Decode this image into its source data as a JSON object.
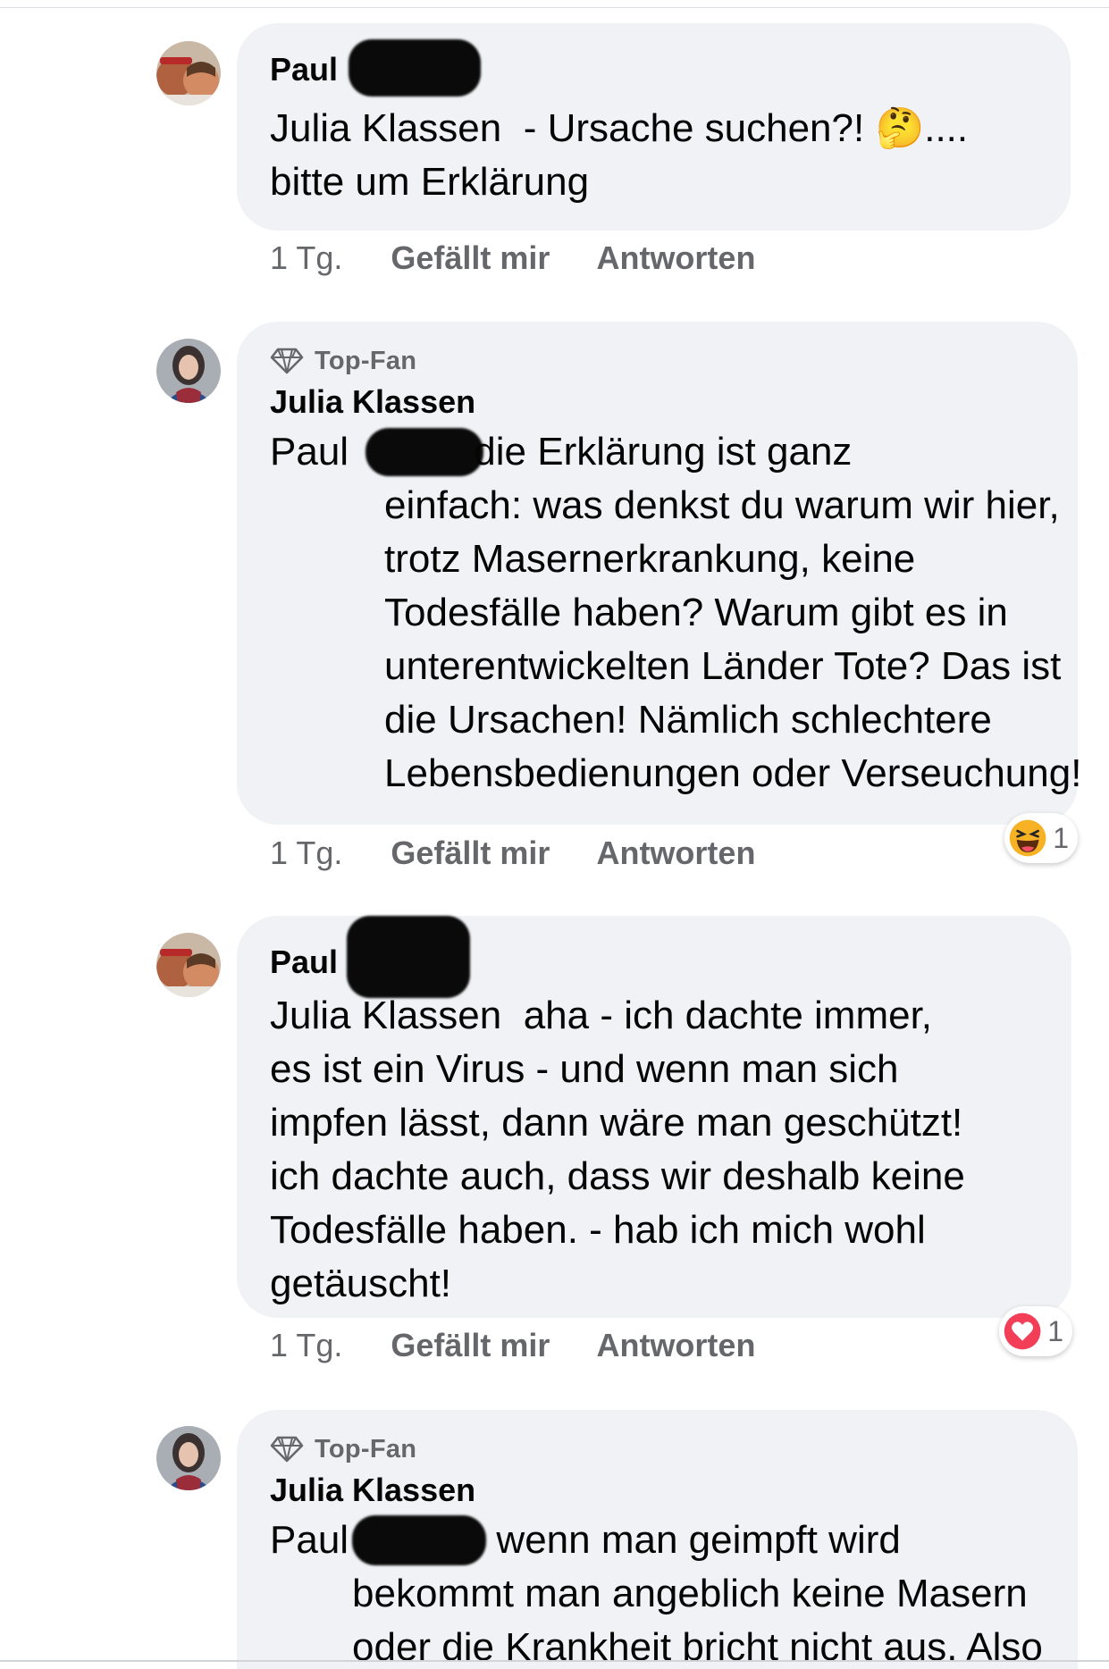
{
  "comments": [
    {
      "author": "Paul",
      "top_fan": false,
      "text": "Julia Klassen  - Ursache suchen?! 🤔....\nbitte um Erklärung",
      "time": "1 Tg.",
      "like_label": "Gefällt mir",
      "reply_label": "Antworten"
    },
    {
      "author": "Julia Klassen",
      "top_fan": true,
      "badge": "Top-Fan",
      "mention": "Paul",
      "text": " die Erklärung ist ganz\neinfach: was denkst du warum wir hier,\ntrotz Masernerkrankung, keine\nTodesfälle haben? Warum gibt es in\nunterentwickelten Länder Tote? Das ist\ndie Ursachen! Nämlich schlechtere\nLebensbedienungen oder Verseuchung!",
      "time": "1 Tg.",
      "like_label": "Gefällt mir",
      "reply_label": "Antworten",
      "reaction": {
        "icon": "haha-reaction-icon",
        "count": "1"
      }
    },
    {
      "author": "Paul",
      "top_fan": false,
      "text": "Julia Klassen  aha - ich dachte immer,\nes ist ein Virus - und wenn man sich\nimpfen lässt, dann wäre man geschützt!\nich dachte auch, dass wir deshalb keine\nTodesfälle haben. - hab ich mich wohl\ngetäuscht!",
      "time": "1 Tg.",
      "like_label": "Gefällt mir",
      "reply_label": "Antworten",
      "reaction": {
        "icon": "love-reaction-icon",
        "count": "1"
      }
    },
    {
      "author": "Julia Klassen",
      "top_fan": true,
      "badge": "Top-Fan",
      "mention": "Paul",
      "text": "      wenn man geimpft wird\nbekommt man angeblich keine Masern\noder die Krankheit bricht nicht aus. Also"
    }
  ],
  "colors": {
    "bubble": "#f0f2f5",
    "secondary_text": "#65676b",
    "primary_text": "#050505",
    "love": "#f33e58",
    "haha": "#f7b125"
  }
}
